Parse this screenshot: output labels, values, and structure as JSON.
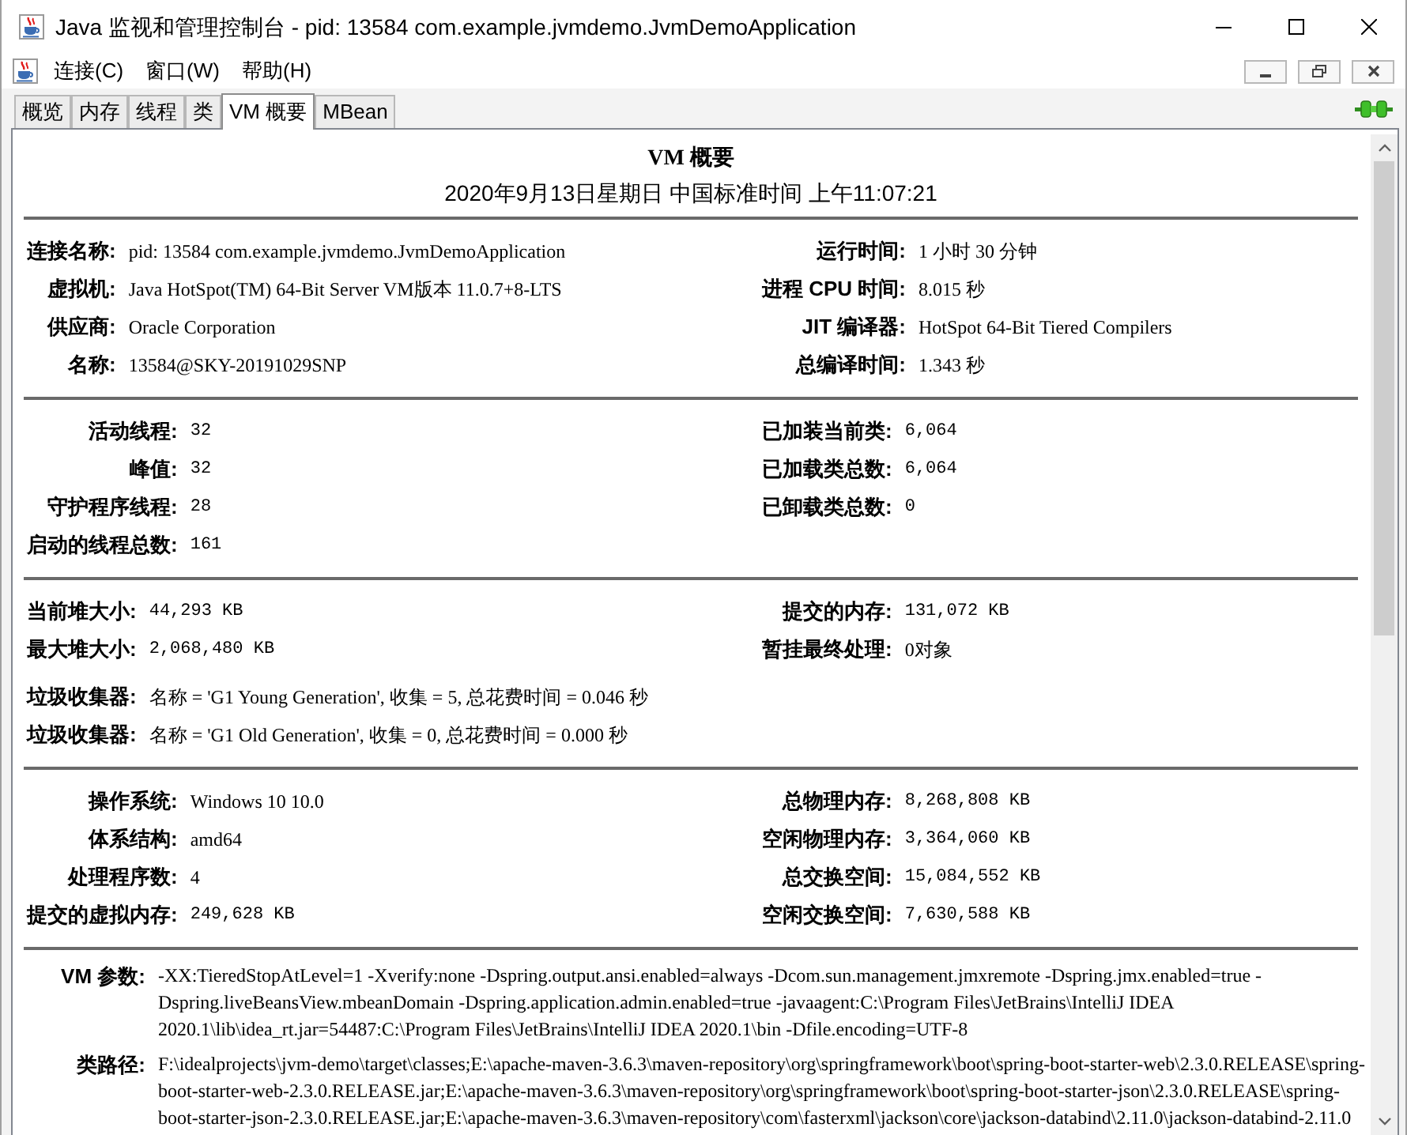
{
  "window": {
    "title": "Java 监视和管理控制台 - pid: 13584 com.example.jvmdemo.JvmDemoApplication"
  },
  "menu_bar": {
    "items": [
      "连接(C)",
      "窗口(W)",
      "帮助(H)"
    ]
  },
  "tabs": [
    {
      "label": "概览",
      "selected": false
    },
    {
      "label": "内存",
      "selected": false
    },
    {
      "label": "线程",
      "selected": false
    },
    {
      "label": "类",
      "selected": false
    },
    {
      "label": "VM 概要",
      "selected": true
    },
    {
      "label": "MBean",
      "selected": false
    }
  ],
  "summary": {
    "title": "VM 概要",
    "timestamp": "2020年9月13日星期日 中国标准时间 上午11:07:21",
    "sections": [
      {
        "left": [
          {
            "label": "连接名称:",
            "value": "pid: 13584 com.example.jvmdemo.JvmDemoApplication",
            "kind": "text"
          },
          {
            "label": "虚拟机:",
            "value": "Java HotSpot(TM) 64-Bit Server VM版本 11.0.7+8-LTS",
            "kind": "text"
          },
          {
            "label": "供应商:",
            "value": "Oracle Corporation",
            "kind": "text"
          },
          {
            "label": "名称:",
            "value": "13584@SKY-20191029SNP",
            "kind": "text"
          }
        ],
        "right": [
          {
            "label": "运行时间:",
            "value": "1 小时 30 分钟",
            "kind": "text"
          },
          {
            "label": "进程 CPU 时间:",
            "value": "8.015 秒",
            "kind": "text"
          },
          {
            "label": "JIT 编译器:",
            "value": "HotSpot 64-Bit Tiered Compilers",
            "kind": "text"
          },
          {
            "label": "总编译时间:",
            "value": "1.343 秒",
            "kind": "text"
          }
        ]
      },
      {
        "left": [
          {
            "label": "活动线程:",
            "value": "32",
            "kind": "number"
          },
          {
            "label": "峰值:",
            "value": "32",
            "kind": "number"
          },
          {
            "label": "守护程序线程:",
            "value": "28",
            "kind": "number"
          },
          {
            "label": "启动的线程总数:",
            "value": "161",
            "kind": "number"
          }
        ],
        "right": [
          {
            "label": "已加装当前类:",
            "value": "6,064",
            "kind": "number"
          },
          {
            "label": "已加载类总数:",
            "value": "6,064",
            "kind": "number"
          },
          {
            "label": "已卸载类总数:",
            "value": "0",
            "kind": "number"
          }
        ]
      },
      {
        "left": [
          {
            "label": "当前堆大小:",
            "value": "44,293 KB",
            "kind": "number"
          },
          {
            "label": "最大堆大小:",
            "value": "2,068,480 KB",
            "kind": "number"
          }
        ],
        "right": [
          {
            "label": "提交的内存:",
            "value": "131,072 KB",
            "kind": "number"
          },
          {
            "label": "暂挂最终处理:",
            "value": "0对象",
            "kind": "text"
          }
        ],
        "full": [
          {
            "label": "垃圾收集器:",
            "value": "名称 = 'G1 Young Generation', 收集 = 5, 总花费时间 = 0.046 秒",
            "kind": "text"
          },
          {
            "label": "垃圾收集器:",
            "value": "名称 = 'G1 Old Generation', 收集 = 0, 总花费时间 = 0.000 秒",
            "kind": "text"
          }
        ]
      },
      {
        "left": [
          {
            "label": "操作系统:",
            "value": "Windows 10 10.0",
            "kind": "text"
          },
          {
            "label": "体系结构:",
            "value": "amd64",
            "kind": "text"
          },
          {
            "label": "处理程序数:",
            "value": "4",
            "kind": "text"
          },
          {
            "label": "提交的虚拟内存:",
            "value": "249,628 KB",
            "kind": "number"
          }
        ],
        "right": [
          {
            "label": "总物理内存:",
            "value": "8,268,808 KB",
            "kind": "number"
          },
          {
            "label": "空闲物理内存:",
            "value": "3,364,060 KB",
            "kind": "number"
          },
          {
            "label": "总交换空间:",
            "value": "15,084,552 KB",
            "kind": "number"
          },
          {
            "label": "空闲交换空间:",
            "value": "7,630,588 KB",
            "kind": "number"
          }
        ]
      }
    ],
    "details": [
      {
        "label": "VM 参数:",
        "value": "-XX:TieredStopAtLevel=1 -Xverify:none -Dspring.output.ansi.enabled=always -Dcom.sun.management.jmxremote -Dspring.jmx.enabled=true -Dspring.liveBeansView.mbeanDomain -Dspring.application.admin.enabled=true -javaagent:C:\\Program Files\\JetBrains\\IntelliJ IDEA 2020.1\\lib\\idea_rt.jar=54487:C:\\Program Files\\JetBrains\\IntelliJ IDEA 2020.1\\bin -Dfile.encoding=UTF-8"
      },
      {
        "label": "类路径:",
        "value": "F:\\idealprojects\\jvm-demo\\target\\classes;E:\\apache-maven-3.6.3\\maven-repository\\org\\springframework\\boot\\spring-boot-starter-web\\2.3.0.RELEASE\\spring-boot-starter-web-2.3.0.RELEASE.jar;E:\\apache-maven-3.6.3\\maven-repository\\org\\springframework\\boot\\spring-boot-starter-json\\2.3.0.RELEASE\\spring-boot-starter-json-2.3.0.RELEASE.jar;E:\\apache-maven-3.6.3\\maven-repository\\com\\fasterxml\\jackson\\core\\jackson-databind\\2.11.0\\jackson-databind-2.11.0"
      }
    ]
  }
}
